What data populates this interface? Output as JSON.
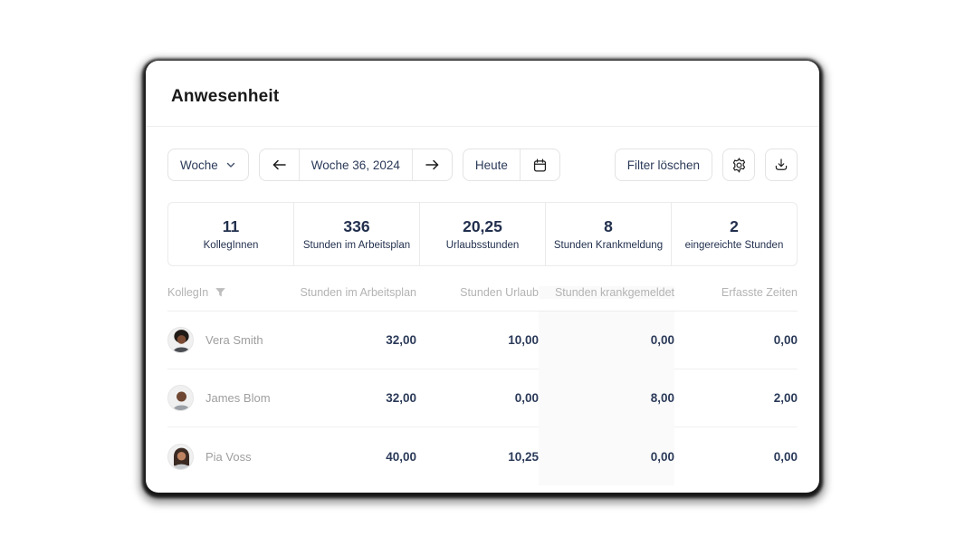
{
  "card": {
    "title": "Anwesenheit"
  },
  "toolbar": {
    "period": {
      "label": "Woche"
    },
    "week_nav": {
      "current": "Woche 36, 2024"
    },
    "today": {
      "label": "Heute"
    },
    "clear_filter": {
      "label": "Filter löschen"
    }
  },
  "stats": {
    "items": [
      {
        "value": "11",
        "label": "KollegInnen"
      },
      {
        "value": "336",
        "label": "Stunden im Arbeitsplan"
      },
      {
        "value": "20,25",
        "label": "Urlaubsstunden"
      },
      {
        "value": "8",
        "label": "Stunden Krankmeldung"
      },
      {
        "value": "2",
        "label": "eingereichte Stunden"
      }
    ]
  },
  "table": {
    "columns": [
      {
        "label": "KollegIn"
      },
      {
        "label": "Stunden im Arbeitsplan"
      },
      {
        "label": "Stunden Urlaub"
      },
      {
        "label": "Stunden krankgemeldet"
      },
      {
        "label": "Erfasste Zeiten"
      }
    ],
    "rows": [
      {
        "name": "Vera Smith",
        "planned": "32,00",
        "vacation": "10,00",
        "sick": "0,00",
        "tracked": "0,00",
        "avatar": {
          "bg": "#f0f0f0",
          "hair": "#201a17",
          "skin": "#7a4a33",
          "shirt": "#4a4d52"
        }
      },
      {
        "name": "James Blom",
        "planned": "32,00",
        "vacation": "0,00",
        "sick": "8,00",
        "tracked": "2,00",
        "avatar": {
          "bg": "#f0f0f0",
          "hair": "#6e4631",
          "skin": "#6e4631",
          "shirt": "#9aa0a6"
        }
      },
      {
        "name": "Pia Voss",
        "planned": "40,00",
        "vacation": "10,25",
        "sick": "0,00",
        "tracked": "0,00",
        "avatar": {
          "bg": "#f0f0f0",
          "hair": "#3a2a22",
          "skin": "#bd8260",
          "shirt": "#c9cccf"
        }
      }
    ]
  },
  "colors": {
    "primary_text": "#2b3a59",
    "title_text": "#191919",
    "muted_text": "#b3b3b3",
    "border": "#e7e7e7"
  }
}
